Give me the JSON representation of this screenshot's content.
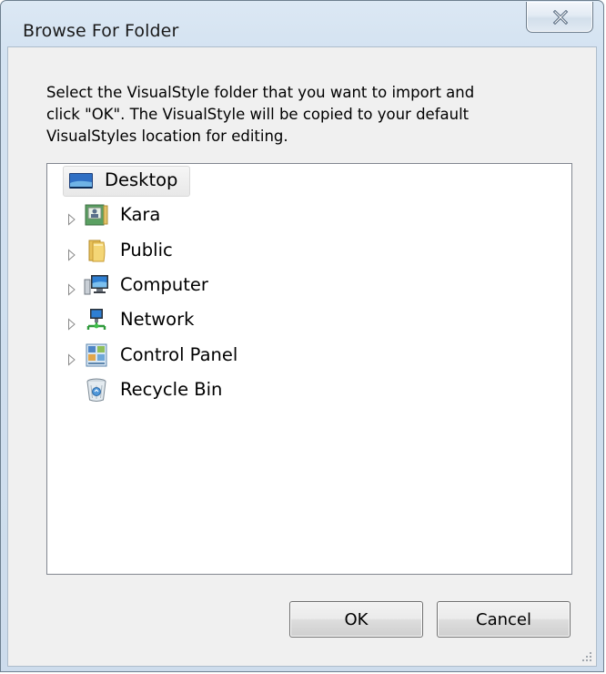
{
  "window": {
    "title": "Browse For Folder"
  },
  "dialog": {
    "description": "Select the VisualStyle folder that you want to import and\nclick \"OK\".  The VisualStyle will be copied to your default\nVisualStyles location for editing."
  },
  "tree": {
    "items": [
      {
        "label": "Desktop",
        "icon": "desktop-icon",
        "expandable": false,
        "selected": true
      },
      {
        "label": "Kara",
        "icon": "user-folder-icon",
        "expandable": true,
        "selected": false
      },
      {
        "label": "Public",
        "icon": "folder-icon",
        "expandable": true,
        "selected": false
      },
      {
        "label": "Computer",
        "icon": "computer-icon",
        "expandable": true,
        "selected": false
      },
      {
        "label": "Network",
        "icon": "network-icon",
        "expandable": true,
        "selected": false
      },
      {
        "label": "Control Panel",
        "icon": "control-panel-icon",
        "expandable": true,
        "selected": false
      },
      {
        "label": "Recycle Bin",
        "icon": "recycle-bin-icon",
        "expandable": false,
        "selected": false
      }
    ]
  },
  "buttons": {
    "ok_label": "OK",
    "cancel_label": "Cancel"
  }
}
